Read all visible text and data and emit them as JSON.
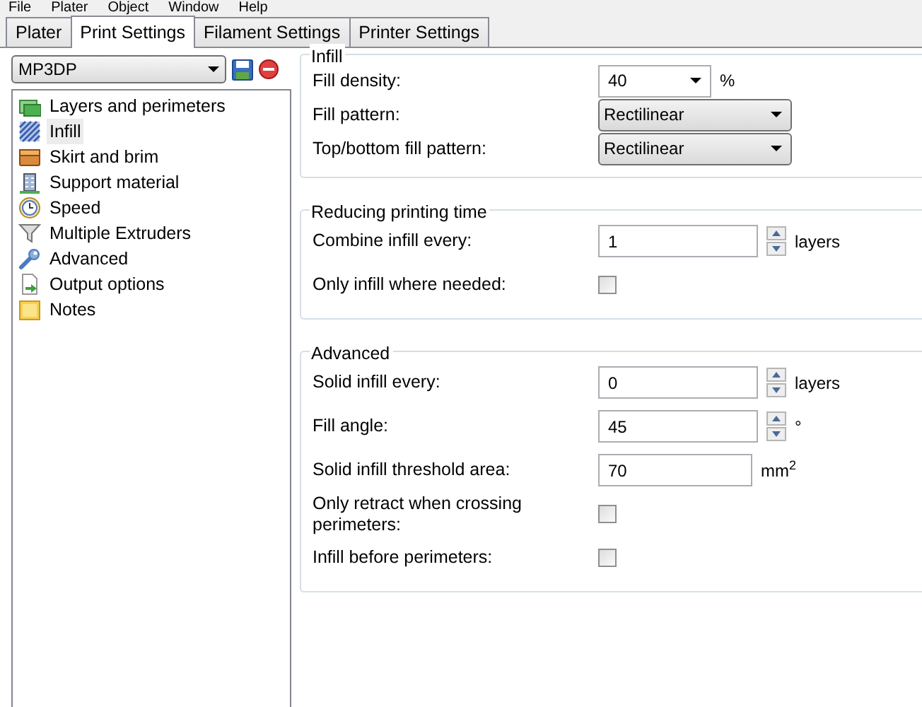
{
  "menu": [
    "File",
    "Plater",
    "Object",
    "Window",
    "Help"
  ],
  "tabs": [
    {
      "label": "Plater",
      "selected": false
    },
    {
      "label": "Print Settings",
      "selected": true
    },
    {
      "label": "Filament Settings",
      "selected": false
    },
    {
      "label": "Printer Settings",
      "selected": false
    }
  ],
  "preset": {
    "value": "MP3DP"
  },
  "sidebar": {
    "items": [
      {
        "label": "Layers and perimeters",
        "selected": false
      },
      {
        "label": "Infill",
        "selected": true
      },
      {
        "label": "Skirt and brim",
        "selected": false
      },
      {
        "label": "Support material",
        "selected": false
      },
      {
        "label": "Speed",
        "selected": false
      },
      {
        "label": "Multiple Extruders",
        "selected": false
      },
      {
        "label": "Advanced",
        "selected": false
      },
      {
        "label": "Output options",
        "selected": false
      },
      {
        "label": "Notes",
        "selected": false
      }
    ]
  },
  "groups": [
    {
      "title": "Infill",
      "fields": [
        {
          "kind": "combo",
          "label": "Fill density:",
          "value": "40",
          "unit": "%"
        },
        {
          "kind": "select",
          "label": "Fill pattern:",
          "value": "Rectilinear"
        },
        {
          "kind": "select",
          "label": "Top/bottom fill pattern:",
          "value": "Rectilinear"
        }
      ]
    },
    {
      "title": "Reducing printing time",
      "fields": [
        {
          "kind": "spin",
          "label": "Combine infill every:",
          "value": "1",
          "unit": "layers"
        },
        {
          "kind": "checkbox",
          "label": "Only infill where needed:",
          "checked": false
        }
      ]
    },
    {
      "title": "Advanced",
      "fields": [
        {
          "kind": "spin",
          "label": "Solid infill every:",
          "value": "0",
          "unit": "layers"
        },
        {
          "kind": "spin",
          "label": "Fill angle:",
          "value": "45",
          "unit": "°"
        },
        {
          "kind": "text",
          "label": "Solid infill threshold area:",
          "value": "70",
          "unit": "mm$^{2}$"
        },
        {
          "kind": "checkbox",
          "label": "Only retract when crossing perimeters:",
          "checked": false
        },
        {
          "kind": "checkbox",
          "label": "Infill before perimeters:",
          "checked": false
        }
      ]
    }
  ]
}
